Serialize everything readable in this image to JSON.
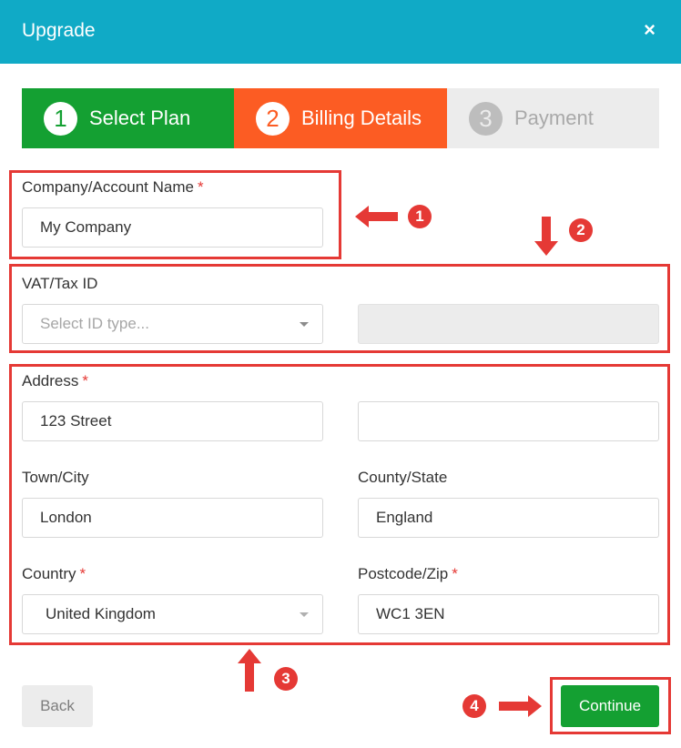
{
  "dialog": {
    "title": "Upgrade",
    "close_symbol": "×"
  },
  "steps": [
    {
      "number": "1",
      "label": "Select Plan",
      "state": "complete"
    },
    {
      "number": "2",
      "label": "Billing Details",
      "state": "active"
    },
    {
      "number": "3",
      "label": "Payment",
      "state": "inactive"
    }
  ],
  "form": {
    "company": {
      "label": "Company/Account Name",
      "required": "*",
      "value": "My Company"
    },
    "vat": {
      "label": "VAT/Tax ID",
      "type_placeholder": "Select ID type...",
      "value": ""
    },
    "address": {
      "label": "Address",
      "required": "*",
      "line1": "123 Street",
      "line2": ""
    },
    "town": {
      "label": "Town/City",
      "value": "London"
    },
    "county": {
      "label": "County/State",
      "value": "England"
    },
    "country": {
      "label": "Country",
      "required": "*",
      "value": "United Kingdom"
    },
    "postcode": {
      "label": "Postcode/Zip",
      "required": "*",
      "value": "WC1 3EN"
    }
  },
  "buttons": {
    "back": "Back",
    "continue": "Continue"
  },
  "annotations": [
    "1",
    "2",
    "3",
    "4"
  ],
  "colors": {
    "header": "#10aac6",
    "step_complete": "#14a032",
    "step_active": "#fc5c23",
    "step_inactive": "#ececec",
    "annotation": "#e53935",
    "continue_button": "#14a032"
  }
}
